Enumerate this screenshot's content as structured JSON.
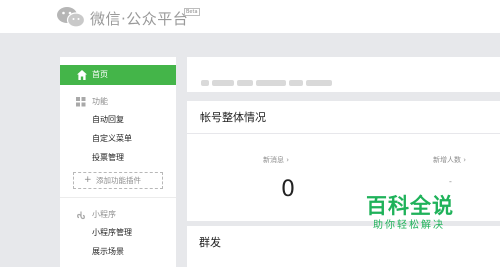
{
  "header": {
    "brand": "微信·公众平台",
    "beta": "Beta",
    "logo_icon": "wechat-logo-icon"
  },
  "sidebar": {
    "home": {
      "label": "首页",
      "icon": "home-icon",
      "active": true
    },
    "sections": [
      {
        "label": "功能",
        "icon": "grid-icon",
        "items": [
          "自动回复",
          "自定义菜单",
          "投票管理"
        ]
      },
      {
        "label": "小程序",
        "icon": "mini-program-icon",
        "items": [
          "小程序管理",
          "展示场景"
        ]
      }
    ],
    "add_plugin": "添加功能插件"
  },
  "main": {
    "account_panel": {
      "title": "帐号整体情况"
    },
    "stats": [
      {
        "label": "新消息",
        "value": "0"
      },
      {
        "label": "新增人数",
        "value": "-"
      }
    ],
    "broadcast_panel": {
      "title": "群发"
    }
  },
  "watermark": {
    "title": "百科全说",
    "subtitle": "助你轻松解决"
  },
  "colors": {
    "accent": "#44b549",
    "background": "#e7e8eb",
    "watermark": "#1fb25a"
  }
}
